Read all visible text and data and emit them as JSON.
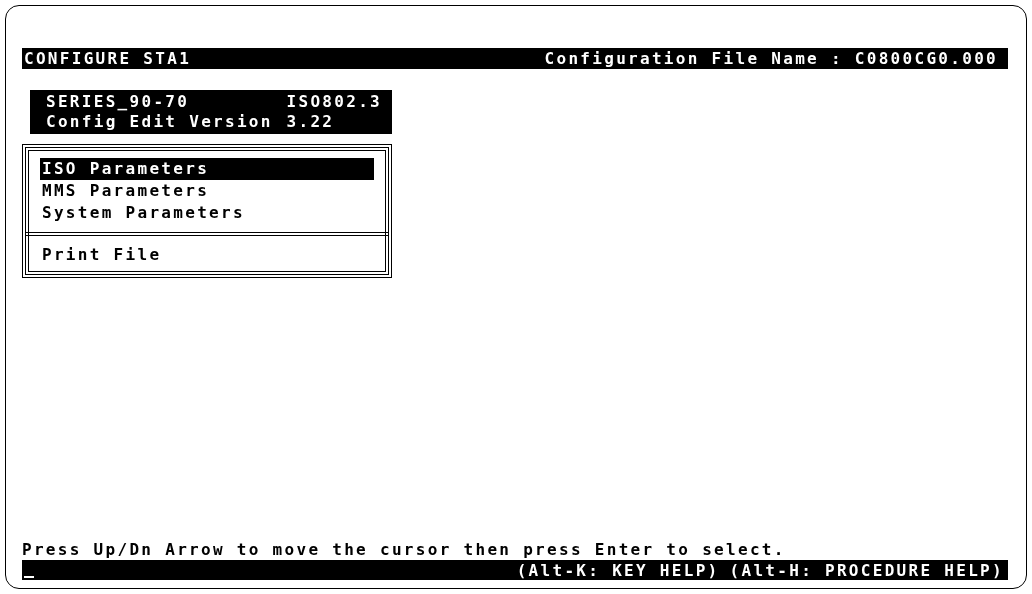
{
  "title_bar": {
    "title": "CONFIGURE STA1",
    "file_label": "Configuration File Name : C0800CG0.000"
  },
  "info": {
    "series": "SERIES_90-70",
    "protocol": "ISO802.3",
    "version_label": "Config Edit Version",
    "version": "3.22"
  },
  "menu": {
    "sections": [
      {
        "items": [
          {
            "label": "ISO Parameters",
            "selected": true
          },
          {
            "label": "MMS Parameters",
            "selected": false
          },
          {
            "label": "System Parameters",
            "selected": false
          }
        ]
      },
      {
        "items": [
          {
            "label": "Print File",
            "selected": false
          }
        ]
      }
    ]
  },
  "hint": "Press Up/Dn Arrow to move the cursor then press Enter to select.",
  "status_bar": {
    "help": [
      "(Alt-K: KEY HELP)",
      "(Alt-H: PROCEDURE HELP)"
    ]
  }
}
